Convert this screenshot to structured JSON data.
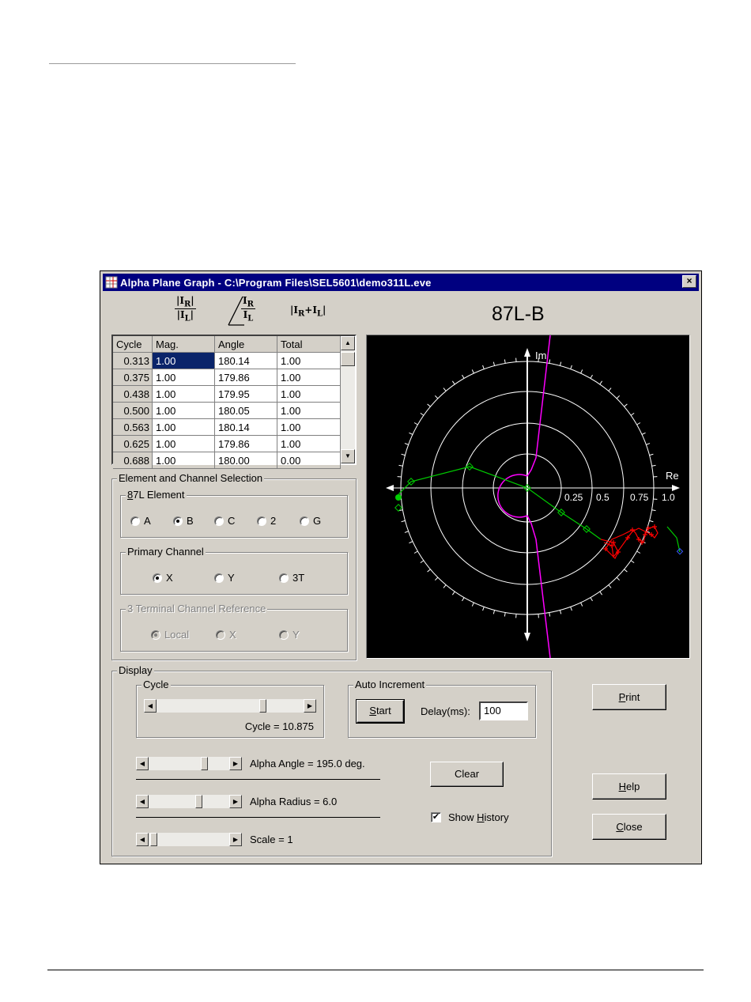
{
  "window": {
    "title": "Alpha Plane Graph - C:\\Program Files\\SEL5601\\demo311L.eve",
    "close_glyph": "×"
  },
  "formulas": {
    "mag_num": "|I",
    "mag_num_sub": "R",
    "mag_den": "|I",
    "mag_den_sub": "L",
    "angle_num": "I",
    "angle_num_sub": "R",
    "angle_den": "I",
    "angle_den_sub": "L",
    "total": "|I",
    "total_sub1": "R",
    "total_mid": "+I",
    "total_sub2": "L",
    "total_end": "|"
  },
  "graph_title": "87L-B",
  "table": {
    "columns": [
      "Cycle",
      "Mag.",
      "Angle",
      "Total"
    ],
    "rows": [
      [
        "0.313",
        "1.00",
        "180.14",
        "1.00"
      ],
      [
        "0.375",
        "1.00",
        "179.86",
        "1.00"
      ],
      [
        "0.438",
        "1.00",
        "179.95",
        "1.00"
      ],
      [
        "0.500",
        "1.00",
        "180.05",
        "1.00"
      ],
      [
        "0.563",
        "1.00",
        "180.14",
        "1.00"
      ],
      [
        "0.625",
        "1.00",
        "179.86",
        "1.00"
      ],
      [
        "0.688",
        "1.00",
        "180.00",
        "0.00"
      ]
    ]
  },
  "selection": {
    "group_label": "Element and Channel Selection",
    "element": {
      "label": "87L Element",
      "options": [
        "A",
        "B",
        "C",
        "2",
        "G"
      ],
      "selected": "B"
    },
    "primary": {
      "label": "Primary Channel",
      "options": [
        "X",
        "Y",
        "3T"
      ],
      "selected": "X"
    },
    "terminal": {
      "label": "3 Terminal Channel Reference",
      "options": [
        "Local",
        "X",
        "Y"
      ],
      "selected": "Local",
      "enabled": false
    }
  },
  "plot": {
    "axis_im": "Im",
    "axis_re": "Re",
    "ring_labels": [
      "0.25",
      "0.5",
      "0.75",
      "1.0"
    ],
    "colors": {
      "background": "#000000",
      "rings": "#ffffff",
      "axis": "#ffffff",
      "boundary": "#ff00ff",
      "green_trace": "#00cc00",
      "red_trace": "#ff0000",
      "current_point": "#3b5bff"
    },
    "alpha_angle_deg": 195.0,
    "alpha_radius": 6.0
  },
  "display": {
    "group_label": "Display",
    "cycle": {
      "label": "Cycle",
      "value_text": "Cycle = 10.875"
    },
    "auto": {
      "label": "Auto Increment",
      "start": "Start",
      "delay_label": "Delay(ms):",
      "delay_value": "100"
    },
    "alpha_angle_text": "Alpha Angle = 195.0 deg.",
    "alpha_radius_text": "Alpha Radius = 6.0",
    "scale_text": "Scale = 1",
    "clear": "Clear",
    "show_history": "Show History",
    "show_history_checked": true
  },
  "buttons": {
    "print": "Print",
    "help": "Help",
    "close": "Close"
  }
}
